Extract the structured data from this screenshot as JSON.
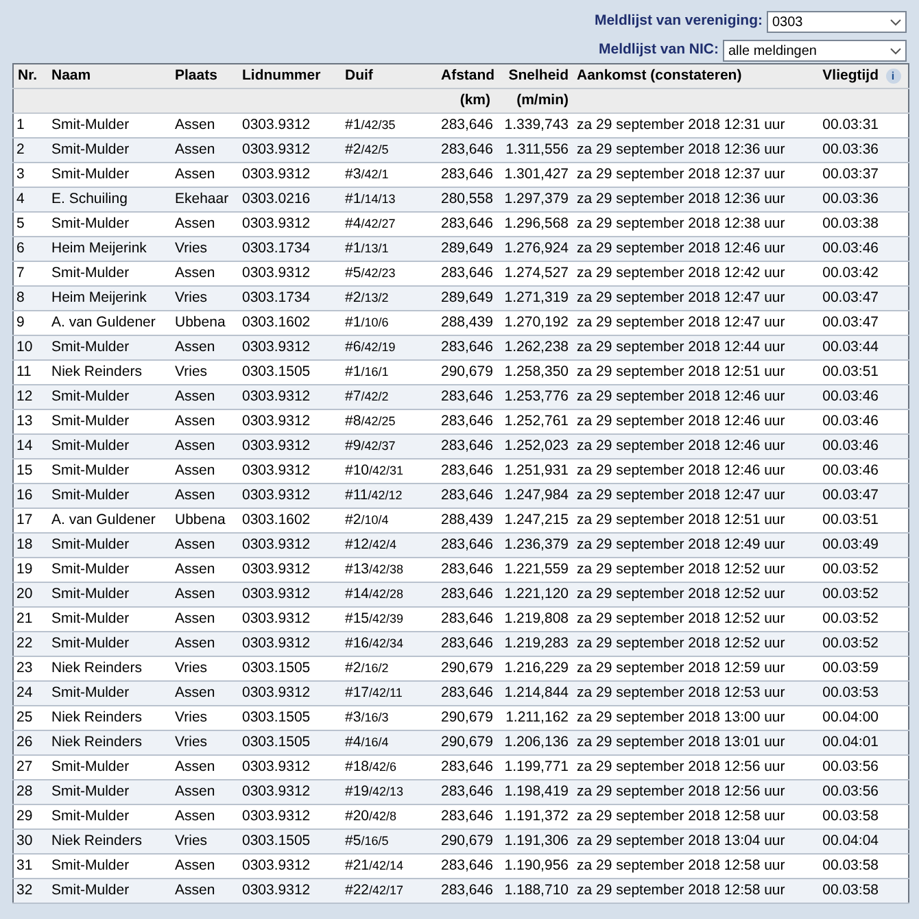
{
  "filters": [
    {
      "label": "Meldlijst van vereniging:",
      "value": "0303"
    },
    {
      "label": "Meldlijst van NIC:",
      "value": "alle meldingen"
    }
  ],
  "table": {
    "columns": [
      {
        "label": "Nr."
      },
      {
        "label": "Naam"
      },
      {
        "label": "Plaats"
      },
      {
        "label": "Lidnummer"
      },
      {
        "label": "Duif"
      },
      {
        "label": "Afstand",
        "unit": "(km)"
      },
      {
        "label": "Snelheid",
        "unit": "(m/min)"
      },
      {
        "label": "Aankomst (constateren)"
      },
      {
        "label": "Vliegtijd",
        "info": "i"
      }
    ],
    "rows": [
      {
        "nr": "1",
        "naam": "Smit-Mulder",
        "plaats": "Assen",
        "lidnummer": "0303.9312",
        "duif": "#1/42/35",
        "afstand": "283,646",
        "snelheid": "1.339,743",
        "aankomst": "za 29 september 2018 12:31 uur",
        "vliegtijd": "00.03:31"
      },
      {
        "nr": "2",
        "naam": "Smit-Mulder",
        "plaats": "Assen",
        "lidnummer": "0303.9312",
        "duif": "#2/42/5",
        "afstand": "283,646",
        "snelheid": "1.311,556",
        "aankomst": "za 29 september 2018 12:36 uur",
        "vliegtijd": "00.03:36"
      },
      {
        "nr": "3",
        "naam": "Smit-Mulder",
        "plaats": "Assen",
        "lidnummer": "0303.9312",
        "duif": "#3/42/1",
        "afstand": "283,646",
        "snelheid": "1.301,427",
        "aankomst": "za 29 september 2018 12:37 uur",
        "vliegtijd": "00.03:37"
      },
      {
        "nr": "4",
        "naam": "E. Schuiling",
        "plaats": "Ekehaar",
        "lidnummer": "0303.0216",
        "duif": "#1/14/13",
        "afstand": "280,558",
        "snelheid": "1.297,379",
        "aankomst": "za 29 september 2018 12:36 uur",
        "vliegtijd": "00.03:36"
      },
      {
        "nr": "5",
        "naam": "Smit-Mulder",
        "plaats": "Assen",
        "lidnummer": "0303.9312",
        "duif": "#4/42/27",
        "afstand": "283,646",
        "snelheid": "1.296,568",
        "aankomst": "za 29 september 2018 12:38 uur",
        "vliegtijd": "00.03:38"
      },
      {
        "nr": "6",
        "naam": "Heim Meijerink",
        "plaats": "Vries",
        "lidnummer": "0303.1734",
        "duif": "#1/13/1",
        "afstand": "289,649",
        "snelheid": "1.276,924",
        "aankomst": "za 29 september 2018 12:46 uur",
        "vliegtijd": "00.03:46"
      },
      {
        "nr": "7",
        "naam": "Smit-Mulder",
        "plaats": "Assen",
        "lidnummer": "0303.9312",
        "duif": "#5/42/23",
        "afstand": "283,646",
        "snelheid": "1.274,527",
        "aankomst": "za 29 september 2018 12:42 uur",
        "vliegtijd": "00.03:42"
      },
      {
        "nr": "8",
        "naam": "Heim Meijerink",
        "plaats": "Vries",
        "lidnummer": "0303.1734",
        "duif": "#2/13/2",
        "afstand": "289,649",
        "snelheid": "1.271,319",
        "aankomst": "za 29 september 2018 12:47 uur",
        "vliegtijd": "00.03:47"
      },
      {
        "nr": "9",
        "naam": "A. van Guldener",
        "plaats": "Ubbena",
        "lidnummer": "0303.1602",
        "duif": "#1/10/6",
        "afstand": "288,439",
        "snelheid": "1.270,192",
        "aankomst": "za 29 september 2018 12:47 uur",
        "vliegtijd": "00.03:47"
      },
      {
        "nr": "10",
        "naam": "Smit-Mulder",
        "plaats": "Assen",
        "lidnummer": "0303.9312",
        "duif": "#6/42/19",
        "afstand": "283,646",
        "snelheid": "1.262,238",
        "aankomst": "za 29 september 2018 12:44 uur",
        "vliegtijd": "00.03:44"
      },
      {
        "nr": "11",
        "naam": "Niek Reinders",
        "plaats": "Vries",
        "lidnummer": "0303.1505",
        "duif": "#1/16/1",
        "afstand": "290,679",
        "snelheid": "1.258,350",
        "aankomst": "za 29 september 2018 12:51 uur",
        "vliegtijd": "00.03:51"
      },
      {
        "nr": "12",
        "naam": "Smit-Mulder",
        "plaats": "Assen",
        "lidnummer": "0303.9312",
        "duif": "#7/42/2",
        "afstand": "283,646",
        "snelheid": "1.253,776",
        "aankomst": "za 29 september 2018 12:46 uur",
        "vliegtijd": "00.03:46"
      },
      {
        "nr": "13",
        "naam": "Smit-Mulder",
        "plaats": "Assen",
        "lidnummer": "0303.9312",
        "duif": "#8/42/25",
        "afstand": "283,646",
        "snelheid": "1.252,761",
        "aankomst": "za 29 september 2018 12:46 uur",
        "vliegtijd": "00.03:46"
      },
      {
        "nr": "14",
        "naam": "Smit-Mulder",
        "plaats": "Assen",
        "lidnummer": "0303.9312",
        "duif": "#9/42/37",
        "afstand": "283,646",
        "snelheid": "1.252,023",
        "aankomst": "za 29 september 2018 12:46 uur",
        "vliegtijd": "00.03:46"
      },
      {
        "nr": "15",
        "naam": "Smit-Mulder",
        "plaats": "Assen",
        "lidnummer": "0303.9312",
        "duif": "#10/42/31",
        "afstand": "283,646",
        "snelheid": "1.251,931",
        "aankomst": "za 29 september 2018 12:46 uur",
        "vliegtijd": "00.03:46"
      },
      {
        "nr": "16",
        "naam": "Smit-Mulder",
        "plaats": "Assen",
        "lidnummer": "0303.9312",
        "duif": "#11/42/12",
        "afstand": "283,646",
        "snelheid": "1.247,984",
        "aankomst": "za 29 september 2018 12:47 uur",
        "vliegtijd": "00.03:47"
      },
      {
        "nr": "17",
        "naam": "A. van Guldener",
        "plaats": "Ubbena",
        "lidnummer": "0303.1602",
        "duif": "#2/10/4",
        "afstand": "288,439",
        "snelheid": "1.247,215",
        "aankomst": "za 29 september 2018 12:51 uur",
        "vliegtijd": "00.03:51"
      },
      {
        "nr": "18",
        "naam": "Smit-Mulder",
        "plaats": "Assen",
        "lidnummer": "0303.9312",
        "duif": "#12/42/4",
        "afstand": "283,646",
        "snelheid": "1.236,379",
        "aankomst": "za 29 september 2018 12:49 uur",
        "vliegtijd": "00.03:49"
      },
      {
        "nr": "19",
        "naam": "Smit-Mulder",
        "plaats": "Assen",
        "lidnummer": "0303.9312",
        "duif": "#13/42/38",
        "afstand": "283,646",
        "snelheid": "1.221,559",
        "aankomst": "za 29 september 2018 12:52 uur",
        "vliegtijd": "00.03:52"
      },
      {
        "nr": "20",
        "naam": "Smit-Mulder",
        "plaats": "Assen",
        "lidnummer": "0303.9312",
        "duif": "#14/42/28",
        "afstand": "283,646",
        "snelheid": "1.221,120",
        "aankomst": "za 29 september 2018 12:52 uur",
        "vliegtijd": "00.03:52"
      },
      {
        "nr": "21",
        "naam": "Smit-Mulder",
        "plaats": "Assen",
        "lidnummer": "0303.9312",
        "duif": "#15/42/39",
        "afstand": "283,646",
        "snelheid": "1.219,808",
        "aankomst": "za 29 september 2018 12:52 uur",
        "vliegtijd": "00.03:52"
      },
      {
        "nr": "22",
        "naam": "Smit-Mulder",
        "plaats": "Assen",
        "lidnummer": "0303.9312",
        "duif": "#16/42/34",
        "afstand": "283,646",
        "snelheid": "1.219,283",
        "aankomst": "za 29 september 2018 12:52 uur",
        "vliegtijd": "00.03:52"
      },
      {
        "nr": "23",
        "naam": "Niek Reinders",
        "plaats": "Vries",
        "lidnummer": "0303.1505",
        "duif": "#2/16/2",
        "afstand": "290,679",
        "snelheid": "1.216,229",
        "aankomst": "za 29 september 2018 12:59 uur",
        "vliegtijd": "00.03:59"
      },
      {
        "nr": "24",
        "naam": "Smit-Mulder",
        "plaats": "Assen",
        "lidnummer": "0303.9312",
        "duif": "#17/42/11",
        "afstand": "283,646",
        "snelheid": "1.214,844",
        "aankomst": "za 29 september 2018 12:53 uur",
        "vliegtijd": "00.03:53"
      },
      {
        "nr": "25",
        "naam": "Niek Reinders",
        "plaats": "Vries",
        "lidnummer": "0303.1505",
        "duif": "#3/16/3",
        "afstand": "290,679",
        "snelheid": "1.211,162",
        "aankomst": "za 29 september 2018 13:00 uur",
        "vliegtijd": "00.04:00"
      },
      {
        "nr": "26",
        "naam": "Niek Reinders",
        "plaats": "Vries",
        "lidnummer": "0303.1505",
        "duif": "#4/16/4",
        "afstand": "290,679",
        "snelheid": "1.206,136",
        "aankomst": "za 29 september 2018 13:01 uur",
        "vliegtijd": "00.04:01"
      },
      {
        "nr": "27",
        "naam": "Smit-Mulder",
        "plaats": "Assen",
        "lidnummer": "0303.9312",
        "duif": "#18/42/6",
        "afstand": "283,646",
        "snelheid": "1.199,771",
        "aankomst": "za 29 september 2018 12:56 uur",
        "vliegtijd": "00.03:56"
      },
      {
        "nr": "28",
        "naam": "Smit-Mulder",
        "plaats": "Assen",
        "lidnummer": "0303.9312",
        "duif": "#19/42/13",
        "afstand": "283,646",
        "snelheid": "1.198,419",
        "aankomst": "za 29 september 2018 12:56 uur",
        "vliegtijd": "00.03:56"
      },
      {
        "nr": "29",
        "naam": "Smit-Mulder",
        "plaats": "Assen",
        "lidnummer": "0303.9312",
        "duif": "#20/42/8",
        "afstand": "283,646",
        "snelheid": "1.191,372",
        "aankomst": "za 29 september 2018 12:58 uur",
        "vliegtijd": "00.03:58"
      },
      {
        "nr": "30",
        "naam": "Niek Reinders",
        "plaats": "Vries",
        "lidnummer": "0303.1505",
        "duif": "#5/16/5",
        "afstand": "290,679",
        "snelheid": "1.191,306",
        "aankomst": "za 29 september 2018 13:04 uur",
        "vliegtijd": "00.04:04"
      },
      {
        "nr": "31",
        "naam": "Smit-Mulder",
        "plaats": "Assen",
        "lidnummer": "0303.9312",
        "duif": "#21/42/14",
        "afstand": "283,646",
        "snelheid": "1.190,956",
        "aankomst": "za 29 september 2018 12:58 uur",
        "vliegtijd": "00.03:58"
      },
      {
        "nr": "32",
        "naam": "Smit-Mulder",
        "plaats": "Assen",
        "lidnummer": "0303.9312",
        "duif": "#22/42/17",
        "afstand": "283,646",
        "snelheid": "1.188,710",
        "aankomst": "za 29 september 2018 12:58 uur",
        "vliegtijd": "00.03:58"
      }
    ]
  }
}
